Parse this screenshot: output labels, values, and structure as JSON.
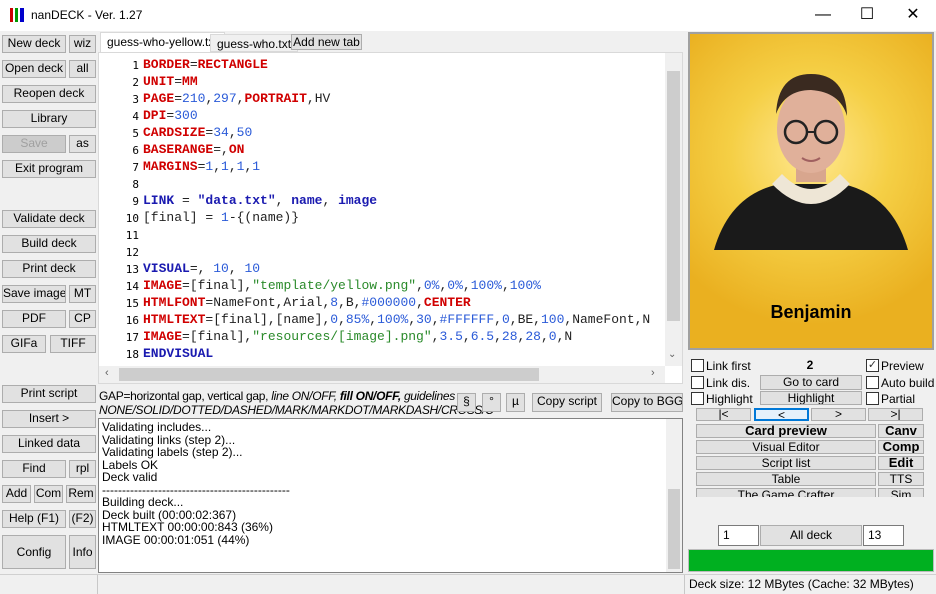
{
  "window": {
    "title": "nanDECK - Ver. 1.27",
    "min": "—",
    "max": "☐",
    "close": "✕"
  },
  "left": {
    "new_deck": "New deck",
    "wiz": "wiz",
    "open_deck": "Open deck",
    "all": "all",
    "reopen": "Reopen deck",
    "library": "Library",
    "save": "Save",
    "as": "as",
    "exit": "Exit program",
    "validate": "Validate deck",
    "build": "Build deck",
    "print_deck": "Print deck",
    "save_images": "Save images",
    "mt": "MT",
    "pdf": "PDF",
    "cp": "CP",
    "gifa": "GIFa",
    "tiff": "TIFF",
    "print_script": "Print script",
    "insert": "Insert >",
    "linked": "Linked data",
    "find": "Find",
    "rpl": "rpl",
    "add": "Add",
    "com": "Com",
    "rem": "Rem",
    "help": "Help (F1)",
    "f2": "(F2)",
    "config": "Config",
    "info": "Info"
  },
  "tabs": [
    {
      "label": "guess-who-yellow.txt",
      "active": true
    },
    {
      "label": "guess-who.txt"
    },
    {
      "label": "Add new tab"
    }
  ],
  "code": [
    [
      [
        "BORDER",
        "kw"
      ],
      [
        "=",
        "pl"
      ],
      [
        "RECTANGLE",
        "kw"
      ]
    ],
    [
      [
        "UNIT",
        "kw"
      ],
      [
        "=",
        "pl"
      ],
      [
        "MM",
        "kw"
      ]
    ],
    [
      [
        "PAGE",
        "kw"
      ],
      [
        "=",
        "pl"
      ],
      [
        "210",
        "num"
      ],
      [
        ",",
        "pl"
      ],
      [
        "297",
        "num"
      ],
      [
        ",",
        "pl"
      ],
      [
        "PORTRAIT",
        "kw"
      ],
      [
        ",HV",
        "pl"
      ]
    ],
    [
      [
        "DPI",
        "kw"
      ],
      [
        "=",
        "pl"
      ],
      [
        "300",
        "num"
      ]
    ],
    [
      [
        "CARDSIZE",
        "kw"
      ],
      [
        "=",
        "pl"
      ],
      [
        "34",
        "num"
      ],
      [
        ",",
        "pl"
      ],
      [
        "50",
        "num"
      ]
    ],
    [
      [
        "BASERANGE",
        "kw"
      ],
      [
        "=,",
        "pl"
      ],
      [
        "ON",
        "kw"
      ]
    ],
    [
      [
        "MARGINS",
        "kw"
      ],
      [
        "=",
        "pl"
      ],
      [
        "1",
        "num"
      ],
      [
        ",",
        "pl"
      ],
      [
        "1",
        "num"
      ],
      [
        ",",
        "pl"
      ],
      [
        "1",
        "num"
      ],
      [
        ",",
        "pl"
      ],
      [
        "1",
        "num"
      ]
    ],
    [],
    [
      [
        "LINK",
        "kw2"
      ],
      [
        " = ",
        "pl"
      ],
      [
        "\"data.txt\"",
        "kw2"
      ],
      [
        ", ",
        "pl"
      ],
      [
        "name",
        "kw2"
      ],
      [
        ", ",
        "pl"
      ],
      [
        "image",
        "kw2"
      ]
    ],
    [
      [
        "[final] = ",
        "pl"
      ],
      [
        "1",
        "num"
      ],
      [
        "-{(name)}",
        "pl"
      ]
    ],
    [],
    [],
    [
      [
        "VISUAL",
        "kw2"
      ],
      [
        "=, ",
        "pl"
      ],
      [
        "10",
        "num"
      ],
      [
        ", ",
        "pl"
      ],
      [
        "10",
        "num"
      ]
    ],
    [
      [
        "IMAGE",
        "kw"
      ],
      [
        "=[final],",
        "pl"
      ],
      [
        "\"template/yellow.png\"",
        "str"
      ],
      [
        ",",
        "pl"
      ],
      [
        "0%",
        "num"
      ],
      [
        ",",
        "pl"
      ],
      [
        "0%",
        "num"
      ],
      [
        ",",
        "pl"
      ],
      [
        "100%",
        "num"
      ],
      [
        ",",
        "pl"
      ],
      [
        "100%",
        "num"
      ]
    ],
    [
      [
        "HTMLFONT",
        "kw"
      ],
      [
        "=NameFont,Arial,",
        "pl"
      ],
      [
        "8",
        "num"
      ],
      [
        ",B,",
        "pl"
      ],
      [
        "#000000",
        "num"
      ],
      [
        ",",
        "pl"
      ],
      [
        "CENTER",
        "kw"
      ]
    ],
    [
      [
        "HTMLTEXT",
        "kw"
      ],
      [
        "=[final],[name],",
        "pl"
      ],
      [
        "0",
        "num"
      ],
      [
        ",",
        "pl"
      ],
      [
        "85%",
        "num"
      ],
      [
        ",",
        "pl"
      ],
      [
        "100%",
        "num"
      ],
      [
        ",",
        "pl"
      ],
      [
        "30",
        "num"
      ],
      [
        ",",
        "pl"
      ],
      [
        "#FFFFFF",
        "num"
      ],
      [
        ",",
        "pl"
      ],
      [
        "0",
        "num"
      ],
      [
        ",BE,",
        "pl"
      ],
      [
        "100",
        "num"
      ],
      [
        ",NameFont,N",
        "pl"
      ]
    ],
    [
      [
        "IMAGE",
        "kw"
      ],
      [
        "=[final],",
        "pl"
      ],
      [
        "\"resources/[image].png\"",
        "str"
      ],
      [
        ",",
        "pl"
      ],
      [
        "3.5",
        "num"
      ],
      [
        ",",
        "pl"
      ],
      [
        "6.5",
        "num"
      ],
      [
        ",",
        "pl"
      ],
      [
        "28",
        "num"
      ],
      [
        ",",
        "pl"
      ],
      [
        "28",
        "num"
      ],
      [
        ",",
        "pl"
      ],
      [
        "0",
        "num"
      ],
      [
        ",N",
        "pl"
      ]
    ],
    [
      [
        "ENDVISUAL",
        "kw2"
      ]
    ]
  ],
  "hint": {
    "line1a": "GAP=horizontal gap, vertical gap, ",
    "line1b": "line ON/OFF, ",
    "line1c": "fill ON/OFF, ",
    "line1d": "guidelines",
    "line2": "NONE/SOLID/DOTTED/DASHED/MARK/MARKDOT/MARKDASH/CROSS/C"
  },
  "tools": {
    "section": "§",
    "degree": "°",
    "micro": "µ",
    "copy_script": "Copy script",
    "copy_bgg": "Copy to BGG"
  },
  "log": [
    "Validating includes...",
    "Validating links (step 2)...",
    "Validating labels (step 2)...",
    "Labels OK",
    "Deck valid",
    "-----------------------------------------------",
    "Building deck...",
    "Deck built (00:00:02:367)",
    "HTMLTEXT 00:00:00:843 (36%)",
    "IMAGE 00:00:01:051 (44%)"
  ],
  "card": {
    "name": "Benjamin",
    "bg": "#f0c030"
  },
  "right": {
    "link_first": "Link first",
    "card_num": "2",
    "preview": "Preview",
    "preview_checked": true,
    "link_dis": "Link dis.",
    "go_to_card": "Go to card",
    "auto_build": "Auto build",
    "highlight_chk": "Highlight",
    "highlight_btn": "Highlight",
    "partial": "Partial",
    "first": "|<",
    "prev": "<",
    "next": ">",
    "last": ">|",
    "card_preview": "Card preview",
    "canv": "Canv",
    "visual_editor": "Visual Editor",
    "comp": "Comp",
    "script_list": "Script list",
    "edit": "Edit",
    "table": "Table",
    "tts": "TTS",
    "game_crafter": "The Game Crafter",
    "sim": "Sim",
    "from": "1",
    "all_deck": "All deck",
    "to": "13",
    "progress": 100,
    "progress_color": "#00b020"
  },
  "status": {
    "deck_size": "Deck size: 12 MBytes (Cache: 32 MBytes)"
  }
}
